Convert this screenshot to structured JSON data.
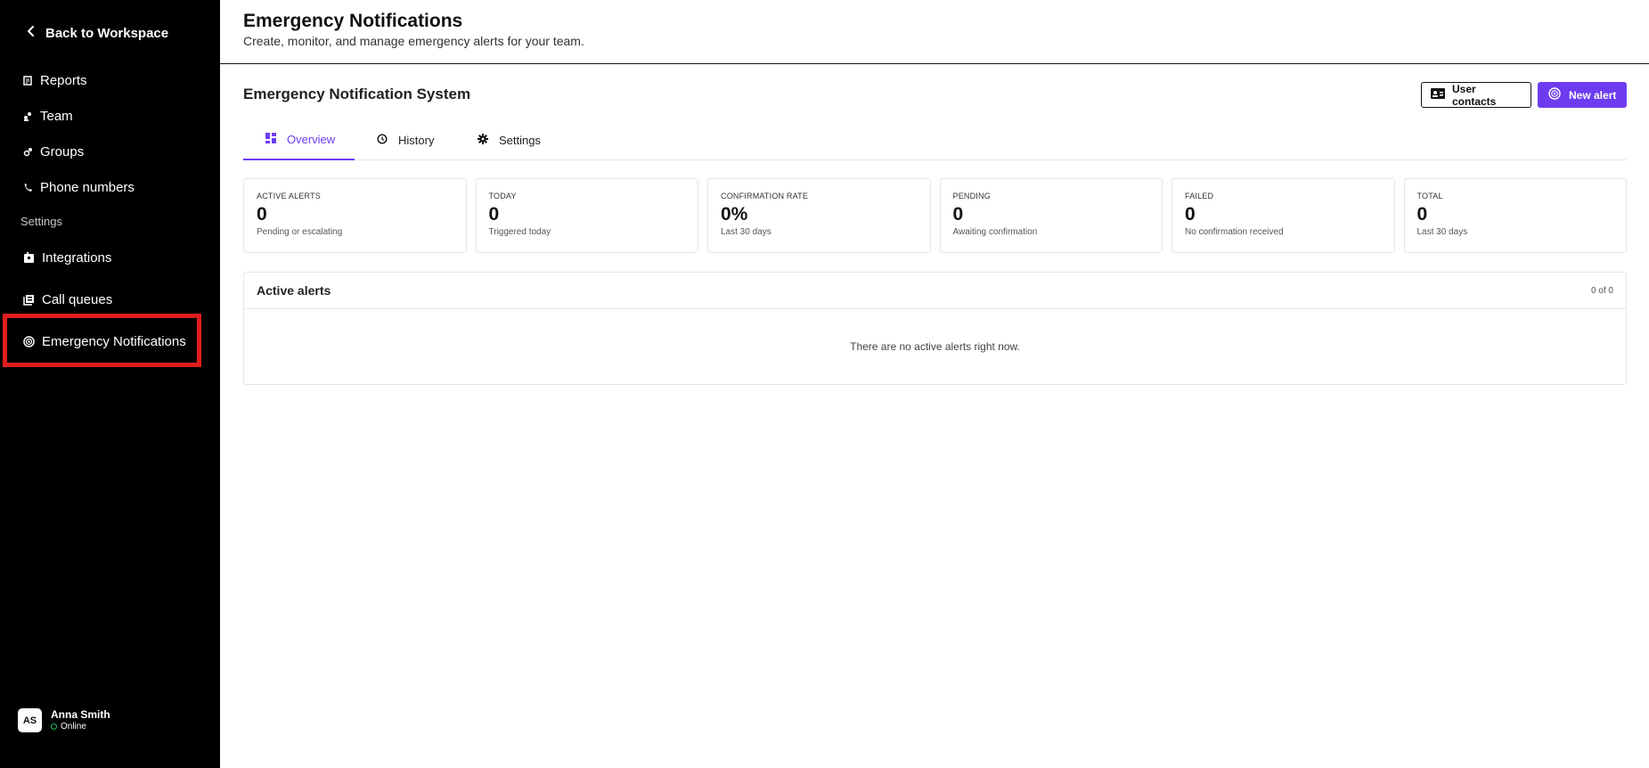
{
  "sidebar": {
    "back_label": "Back to Workspace",
    "items": [
      {
        "label": "Reports",
        "icon": "reports-icon"
      },
      {
        "label": "Team",
        "icon": "team-icon"
      },
      {
        "label": "Groups",
        "icon": "groups-icon"
      },
      {
        "label": "Phone numbers",
        "icon": "phone-icon"
      }
    ],
    "settings_heading": "Settings",
    "settings_items": [
      {
        "label": "Integrations",
        "icon": "integrations-icon"
      },
      {
        "label": "Call queues",
        "icon": "call-queues-icon"
      },
      {
        "label": "Emergency Notifications",
        "icon": "emergency-icon"
      }
    ],
    "highlight_color": "#e11d1d"
  },
  "user": {
    "initials": "AS",
    "name": "Anna Smith",
    "status": "Online",
    "status_color": "#22c55e"
  },
  "header": {
    "title": "Emergency Notifications",
    "subtitle": "Create, monitor, and manage emergency alerts for your team."
  },
  "main": {
    "section_title": "Emergency Notification System",
    "buttons": {
      "user_contacts": "User contacts",
      "new_alert": "New alert"
    },
    "accent_color": "#6d3cf0",
    "tabs": [
      {
        "label": "Overview",
        "active": true
      },
      {
        "label": "History",
        "active": false
      },
      {
        "label": "Settings",
        "active": false
      }
    ],
    "stats": [
      {
        "label": "ACTIVE ALERTS",
        "value": "0",
        "sub": "Pending or escalating"
      },
      {
        "label": "TODAY",
        "value": "0",
        "sub": "Triggered today"
      },
      {
        "label": "CONFIRMATION RATE",
        "value": "0%",
        "sub": "Last 30 days"
      },
      {
        "label": "PENDING",
        "value": "0",
        "sub": "Awaiting confirmation"
      },
      {
        "label": "FAILED",
        "value": "0",
        "sub": "No confirmation received"
      },
      {
        "label": "TOTAL",
        "value": "0",
        "sub": "Last 30 days"
      }
    ],
    "active_alerts": {
      "title": "Active alerts",
      "count": "0 of 0",
      "empty_message": "There are no active alerts right now."
    }
  }
}
